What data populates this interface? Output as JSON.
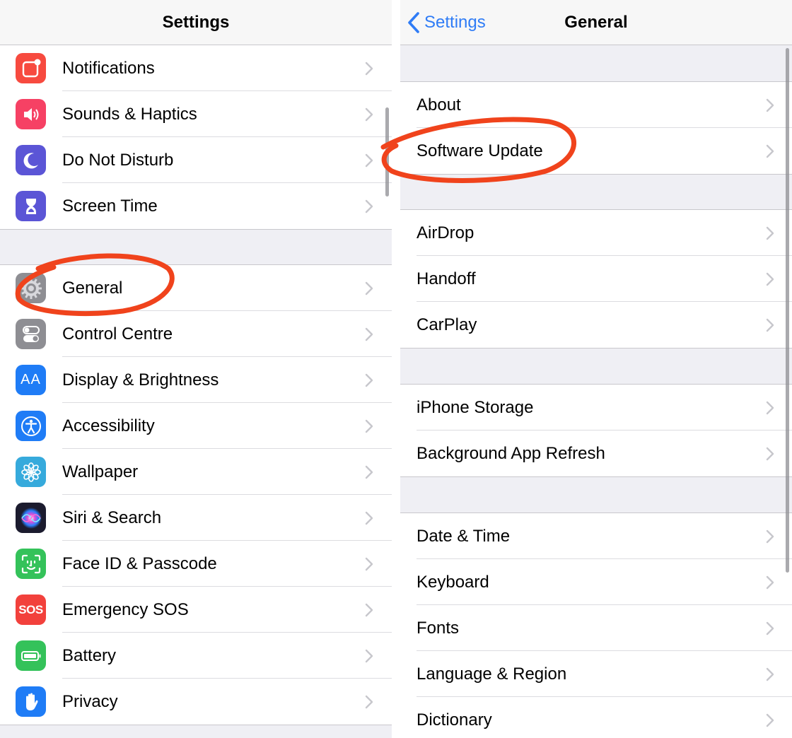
{
  "left_panel": {
    "title": "Settings",
    "groups": [
      [
        {
          "label": "Notifications",
          "icon": "notifications-icon",
          "color": "#f74a3f"
        },
        {
          "label": "Sounds & Haptics",
          "icon": "speaker-icon",
          "color": "#f64164"
        },
        {
          "label": "Do Not Disturb",
          "icon": "moon-icon",
          "color": "#5b55d6"
        },
        {
          "label": "Screen Time",
          "icon": "hourglass-icon",
          "color": "#5b55d6"
        }
      ],
      [
        {
          "label": "General",
          "icon": "gear-icon",
          "color": "#8e8e93"
        },
        {
          "label": "Control Centre",
          "icon": "toggles-icon",
          "color": "#8e8e93"
        },
        {
          "label": "Display & Brightness",
          "icon": "text-size-icon",
          "color": "#1f7cf6"
        },
        {
          "label": "Accessibility",
          "icon": "accessibility-icon",
          "color": "#1f7cf6"
        },
        {
          "label": "Wallpaper",
          "icon": "flower-icon",
          "color": "#36aadc"
        },
        {
          "label": "Siri & Search",
          "icon": "siri-icon",
          "color": "#1b1b2e"
        },
        {
          "label": "Face ID & Passcode",
          "icon": "face-id-icon",
          "color": "#34c25a"
        },
        {
          "label": "Emergency SOS",
          "icon": "sos-icon",
          "color": "#f2413c"
        },
        {
          "label": "Battery",
          "icon": "battery-icon",
          "color": "#34c25a"
        },
        {
          "label": "Privacy",
          "icon": "hand-icon",
          "color": "#1f7cf6"
        }
      ]
    ],
    "sos_text": "SOS",
    "aa_text": "AA"
  },
  "right_panel": {
    "title": "General",
    "back_label": "Settings",
    "groups": [
      [
        {
          "label": "About"
        },
        {
          "label": "Software Update"
        }
      ],
      [
        {
          "label": "AirDrop"
        },
        {
          "label": "Handoff"
        },
        {
          "label": "CarPlay"
        }
      ],
      [
        {
          "label": "iPhone Storage"
        },
        {
          "label": "Background App Refresh"
        }
      ],
      [
        {
          "label": "Date & Time"
        },
        {
          "label": "Keyboard"
        },
        {
          "label": "Fonts"
        },
        {
          "label": "Language & Region"
        },
        {
          "label": "Dictionary"
        }
      ]
    ]
  },
  "colors": {
    "accent": "#2f7cf6",
    "annotation": "#f0431c",
    "chevron": "#c7c7cc"
  }
}
